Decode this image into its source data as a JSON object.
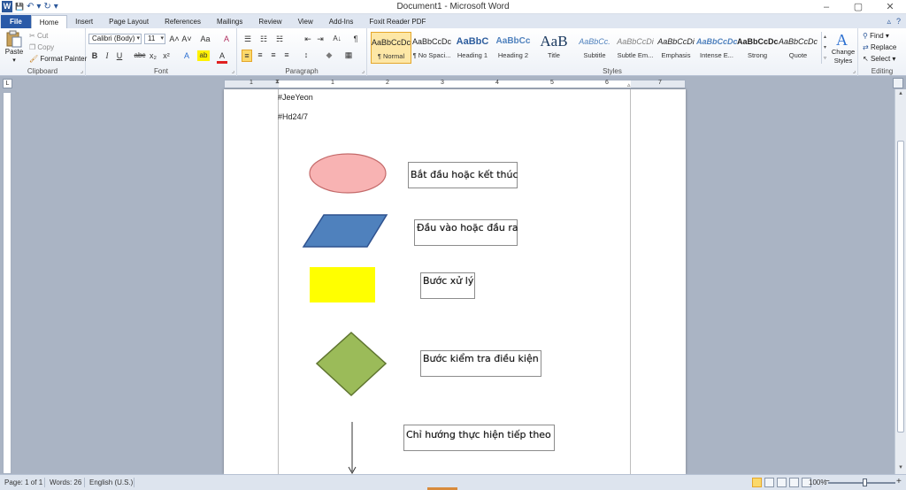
{
  "window": {
    "title": "Document1 - Microsoft Word",
    "app_icon": "W",
    "controls": {
      "minimize": "–",
      "maximize": "▢",
      "close": "✕"
    }
  },
  "qat": {
    "save": "💾",
    "undo": "↶",
    "undo_dd": "▾",
    "redo": "↻",
    "customize": "▾"
  },
  "tabs": [
    {
      "label": "File"
    },
    {
      "label": "Home"
    },
    {
      "label": "Insert"
    },
    {
      "label": "Page Layout"
    },
    {
      "label": "References"
    },
    {
      "label": "Mailings"
    },
    {
      "label": "Review"
    },
    {
      "label": "View"
    },
    {
      "label": "Add-Ins"
    },
    {
      "label": "Foxit Reader PDF"
    }
  ],
  "tab_right": {
    "minimize_ribbon": "▵",
    "help": "?"
  },
  "clipboard": {
    "label": "Clipboard",
    "paste": "Paste",
    "cut": "Cut",
    "copy": "Copy",
    "format_painter": "Format Painter"
  },
  "font": {
    "label": "Font",
    "family": "Calibri (Body)",
    "size": "11",
    "grow": "A˄",
    "shrink": "A˅",
    "change_case": "Aa",
    "clear": "A",
    "bold": "B",
    "italic": "I",
    "underline": "U",
    "strike": "abc",
    "subscript": "x₂",
    "superscript": "x²",
    "effects": "A",
    "highlight": "ab",
    "font_color": "A"
  },
  "paragraph": {
    "label": "Paragraph",
    "bullets": "☰",
    "numbering": "☷",
    "multilevel": "☵",
    "decrease_indent": "⇤",
    "increase_indent": "⇥",
    "sort": "A↓",
    "show_marks": "¶",
    "align_left": "≡",
    "center": "≡",
    "align_right": "≡",
    "justify": "≡",
    "line_spacing": "↕",
    "shading": "◆",
    "borders": "▦"
  },
  "styles": {
    "label": "Styles",
    "items": [
      {
        "preview": "AaBbCcDc",
        "name": "¶ Normal"
      },
      {
        "preview": "AaBbCcDc",
        "name": "¶ No Spaci..."
      },
      {
        "preview": "AaBbC",
        "name": "Heading 1"
      },
      {
        "preview": "AaBbCc",
        "name": "Heading 2"
      },
      {
        "preview": "AaB",
        "name": "Title"
      },
      {
        "preview": "AaBbCc.",
        "name": "Subtitle"
      },
      {
        "preview": "AaBbCcDi",
        "name": "Subtle Em..."
      },
      {
        "preview": "AaBbCcDi",
        "name": "Emphasis"
      },
      {
        "preview": "AaBbCcDc",
        "name": "Intense E..."
      },
      {
        "preview": "AaBbCcDc",
        "name": "Strong"
      },
      {
        "preview": "AaBbCcDc",
        "name": "Quote"
      }
    ],
    "change_styles": "Change Styles"
  },
  "editing": {
    "label": "Editing",
    "find": "Find",
    "replace": "Replace",
    "select": "Select"
  },
  "ruler": {
    "tab_selector": "L",
    "numbers": [
      "1",
      "1",
      "2",
      "3",
      "4",
      "5",
      "6",
      "7"
    ]
  },
  "document": {
    "lines": [
      "#JeeYeon",
      "#Hd24/7"
    ],
    "shape_labels": [
      "Bắt đầu hoặc kết thúc",
      "Đầu vào hoặc đầu ra",
      "Bước xử lý",
      "Bước kiểm tra điều kiện",
      "Chỉ hướng thực hiện tiếp theo"
    ],
    "colors": {
      "ellipse_fill": "#f8b3b3",
      "ellipse_stroke": "#c46a6a",
      "parallelogram_fill": "#4f81bd",
      "parallelogram_stroke": "#2f528f",
      "rect_fill": "#ffff00",
      "diamond_fill": "#9bbb59",
      "diamond_stroke": "#5f7530"
    }
  },
  "status": {
    "page": "Page: 1 of 1",
    "words": "Words: 26",
    "language": "English (U.S.)",
    "zoom": "100%",
    "zoom_out": "−",
    "zoom_in": "+"
  }
}
